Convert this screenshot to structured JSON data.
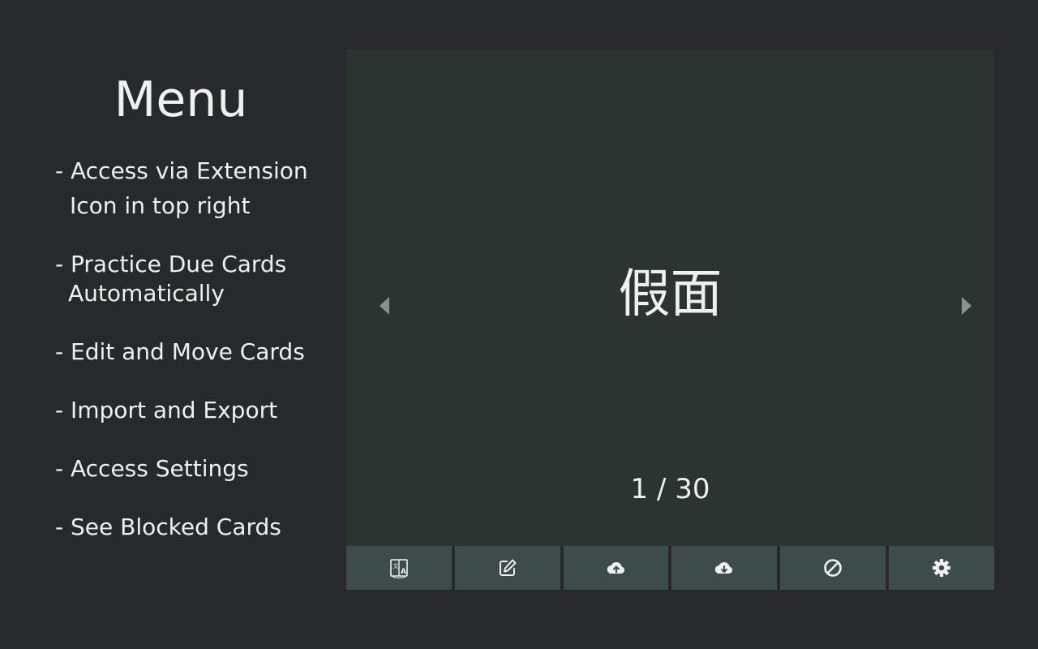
{
  "menu": {
    "title": "Menu",
    "items": [
      {
        "line1": "- Access via Extension",
        "line2": "Icon in top right"
      },
      {
        "line1": "- Practice Due Cards",
        "line2": "Automatically"
      },
      {
        "line1": "- Edit and Move Cards",
        "line2": ""
      },
      {
        "line1": "- Import and Export",
        "line2": ""
      },
      {
        "line1": "- Access Settings",
        "line2": ""
      },
      {
        "line1": "- See Blocked Cards",
        "line2": ""
      }
    ]
  },
  "card": {
    "text": "假面",
    "counter": "1 / 30",
    "prev_icon": "caret-left-icon",
    "next_icon": "caret-right-icon"
  },
  "toolbar": {
    "buttons": [
      {
        "icon": "translate-icon"
      },
      {
        "icon": "edit-icon"
      },
      {
        "icon": "cloud-upload-icon"
      },
      {
        "icon": "cloud-download-icon"
      },
      {
        "icon": "block-icon"
      },
      {
        "icon": "gear-icon"
      }
    ]
  },
  "colors": {
    "background": "#27292d",
    "card_background": "#2c3432",
    "toolbar_button": "#3d4b4a",
    "text": "#eef1ef"
  }
}
